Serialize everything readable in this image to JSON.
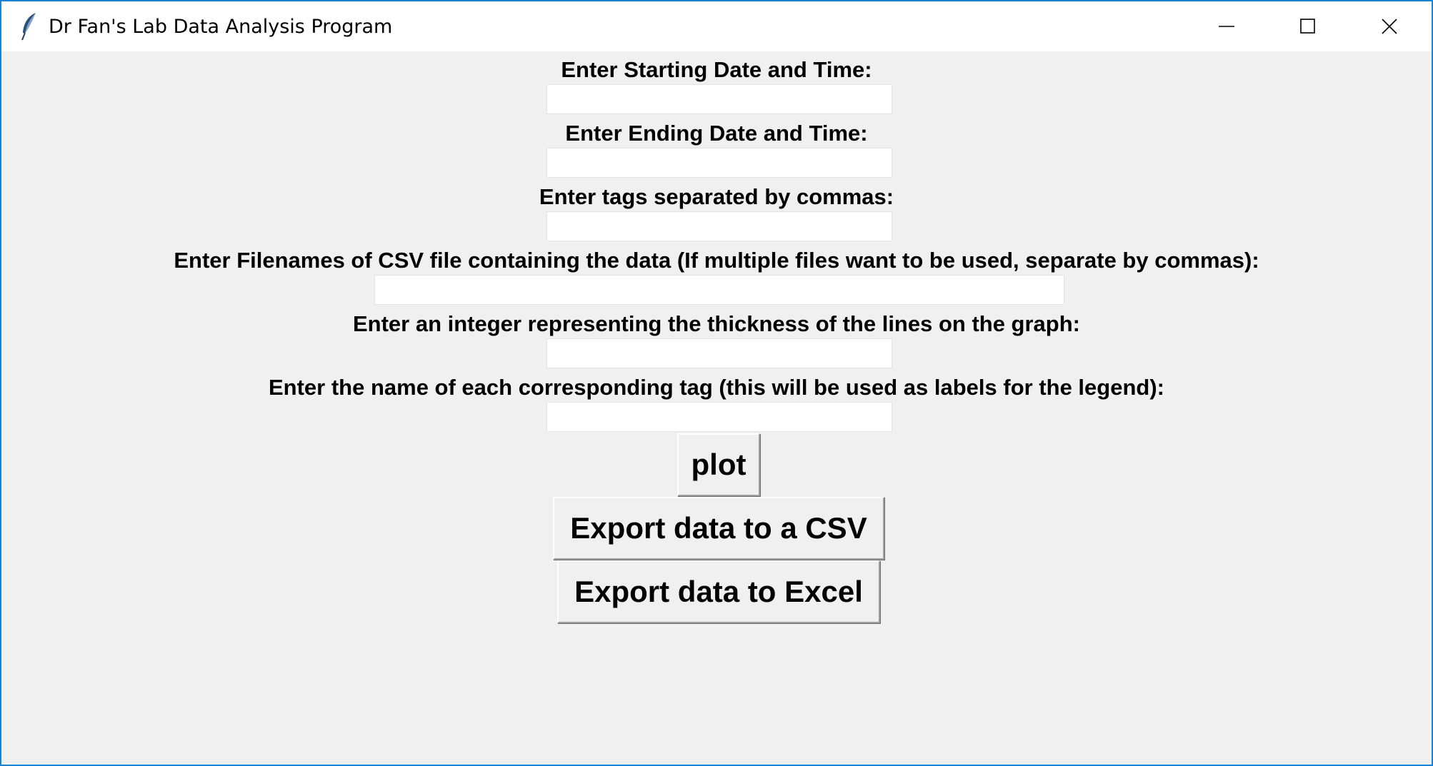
{
  "window": {
    "title": "Dr Fan's Lab Data Analysis Program",
    "icon": "feather-icon",
    "controls": [
      "minimize-icon",
      "maximize-icon",
      "close-icon"
    ]
  },
  "form": {
    "start_label": "Enter Starting Date and Time:",
    "start_value": "",
    "end_label": "Enter Ending Date and Time:",
    "end_value": "",
    "tags_label": "Enter tags separated by commas:",
    "tags_value": "",
    "files_label": "Enter Filenames of CSV file containing the data (If multiple files want to be used, separate by commas):",
    "files_value": "",
    "thickness_label": "Enter an integer representing the thickness of the lines on the graph:",
    "thickness_value": "",
    "legend_label": "Enter the name of each corresponding tag (this will be used as labels for the legend):",
    "legend_value": ""
  },
  "buttons": {
    "plot": "plot",
    "export_csv": "Export data to a CSV",
    "export_excel": "Export data to Excel"
  },
  "colors": {
    "window_border": "#1883d7",
    "background": "#f0f0f0"
  }
}
